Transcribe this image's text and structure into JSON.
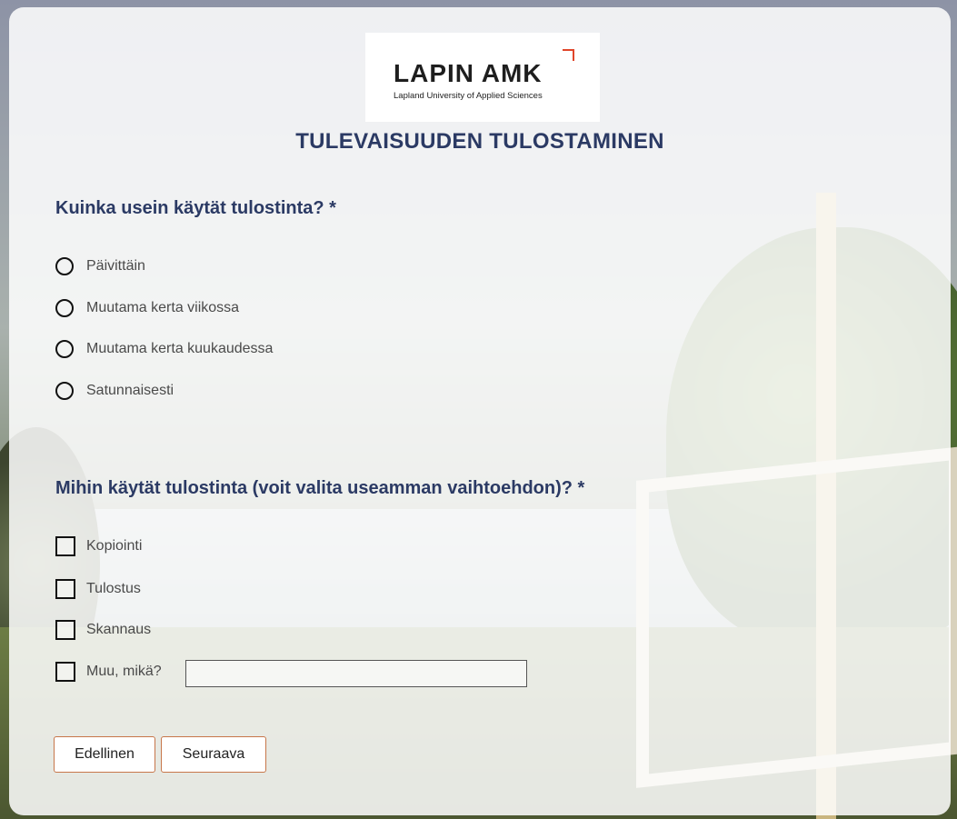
{
  "logo": {
    "name": "LAPIN AMK",
    "subtitle": "Lapland University of Applied Sciences",
    "accent_color": "#e0452a"
  },
  "page_title": "TULEVAISUUDEN TULOSTAMINEN",
  "question1": {
    "text": "Kuinka usein käytät tulostinta? *",
    "options": [
      "Päivittäin",
      "Muutama kerta viikossa",
      "Muutama kerta kuukaudessa",
      "Satunnaisesti"
    ]
  },
  "question2": {
    "text": "Mihin käytät tulostinta (voit valita useamman vaihtoehdon)? *",
    "options": [
      "Kopiointi",
      "Tulostus",
      "Skannaus",
      "Muu, mikä?"
    ],
    "other_value": ""
  },
  "buttons": {
    "previous": "Edellinen",
    "next": "Seuraava"
  },
  "colors": {
    "heading": "#2b3a64",
    "button_border": "#c7764a"
  }
}
